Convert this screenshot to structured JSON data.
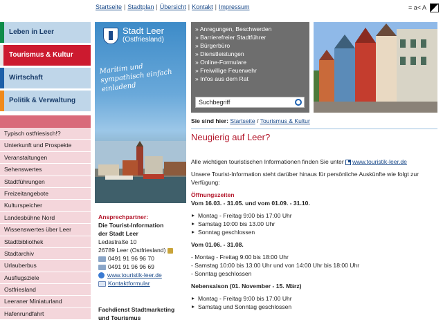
{
  "topnav": {
    "links": [
      "Startseite",
      "Stadtplan",
      "Übersicht",
      "Kontakt",
      "Impressum"
    ],
    "fontsize_label": "= a< A"
  },
  "mainnav": [
    {
      "label": "Leben in Leer",
      "color": "#0f8c49"
    },
    {
      "label": "Tourismus & Kultur",
      "color": "#d2132b"
    },
    {
      "label": "Wirtschaft",
      "color": "#1d5fa8"
    },
    {
      "label": "Politik & Verwaltung",
      "color": "#f08a1c"
    }
  ],
  "subnav": [
    "Typisch ostfriesisch!?",
    "Unterkunft und Prospekte",
    "Veranstaltungen",
    "Sehenswertes",
    "Stadtführungen",
    "Freizeitangebote",
    "Kulturspeicher",
    "Landesbühne Nord",
    "Wissenswertes über Leer",
    "Stadtbibliothek",
    "Stadtarchiv",
    "Urlauberbus",
    "Ausflugsziele",
    "Ostfriesland",
    "Leeraner Miniaturland",
    "Hafenrundfahrt"
  ],
  "promo": {
    "city": "Stadt Leer",
    "sub": "(Ostfriesland)",
    "slogan": "Maritim und sympathisch einfach einladend"
  },
  "quicklinks": [
    "Anregungen, Beschwerden",
    "Barrierefreier Stadtführer",
    "Bürgerbüro",
    "Dienstleistungen",
    "Online-Formulare",
    "Freiwillige Feuerwehr",
    "Infos aus dem Rat"
  ],
  "search": {
    "placeholder": "Suchbegriff"
  },
  "contact": {
    "head": "Ansprechpartner:",
    "org1": "Die Tourist-Information",
    "org2": "der Stadt Leer",
    "street": "Ledastraße 10",
    "city": "26789 Leer (Ostfriesland)",
    "phone": "0491 91 96 96 70",
    "fax": "0491 91 96 96 69",
    "web": "www.touristik-leer.de",
    "mail": "Kontaktformular"
  },
  "fachdienst": [
    "Fachdienst Stadtmarketing",
    "und Tourismus"
  ],
  "breadcrumb": {
    "label": "Sie sind hier:",
    "items": [
      "Startseite",
      "Tourismus & Kultur"
    ],
    "sep": "/"
  },
  "content": {
    "title": "Neugierig auf Leer?",
    "intro_text": "Alle wichtigen touristischen Informationen finden Sie unter",
    "intro_link": "www.touristik-leer.de",
    "para2": "Unsere Tourist-Information steht darüber hinaus für persönliche Auskünfte wie folgt zur Verfügung:",
    "oeffnung": "Öffnungszeiten",
    "period1": "Vom 16.03. - 31.05. und vom 01.09. - 31.10.",
    "period1_items": [
      "Montag - Freitag 9:00 bis 17:00 Uhr",
      "Samstag 10:00 bis 13.00 Uhr",
      "Sonntag geschlossen"
    ],
    "period2": "Vom 01.06. - 31.08.",
    "period2_items": [
      "- Montag - Freitag 9:00 bis 18:00 Uhr",
      "- Samstag 10:00 bis 13:00 Uhr und von 14:00 Uhr bis 18:00 Uhr",
      "- Sonntag geschlossen"
    ],
    "period3": "Nebensaison (01. November - 15. März)",
    "period3_items": [
      "Montag - Freitag 9:00 bis 17:00 Uhr",
      "Samstag und Sonntag geschlossen"
    ]
  }
}
